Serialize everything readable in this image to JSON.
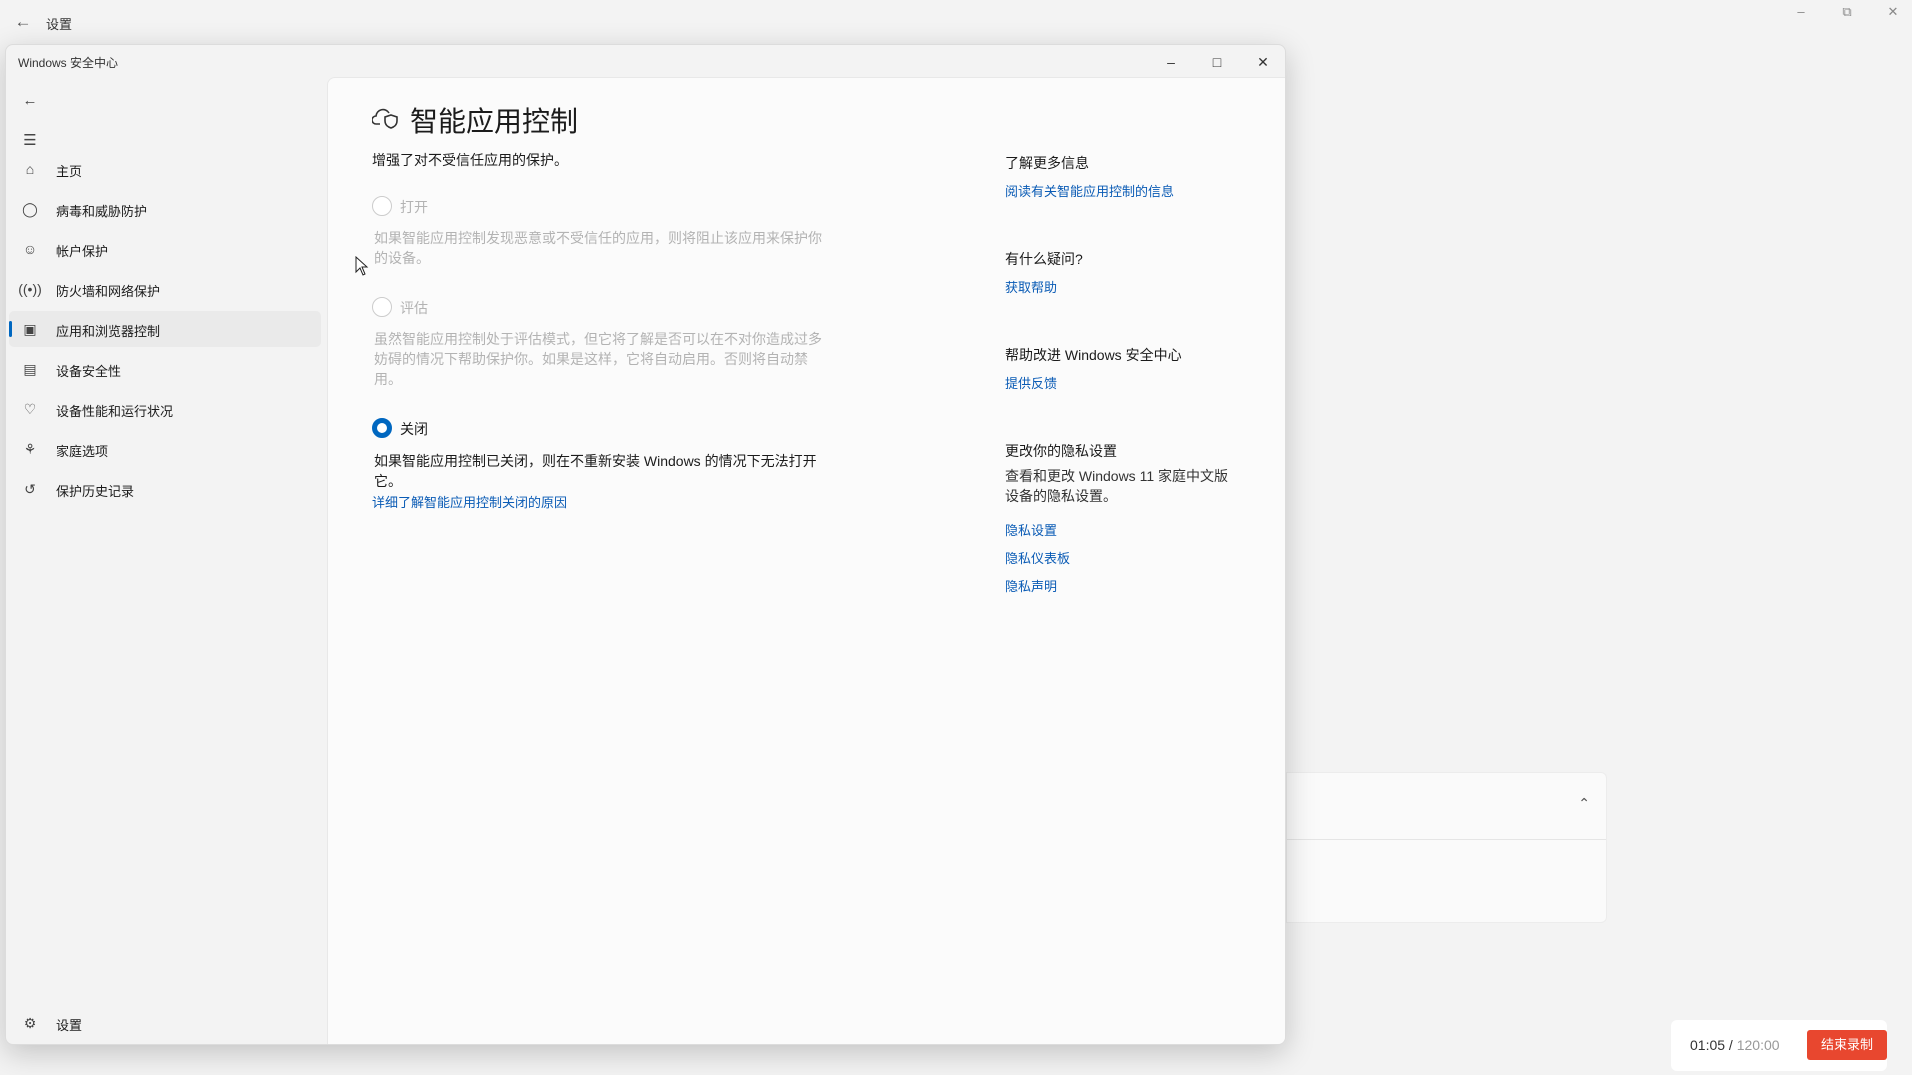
{
  "outer": {
    "title": "设置",
    "back_icon": "arrow-left"
  },
  "window": {
    "title": "Windows 安全中心",
    "sidebar": {
      "items": [
        {
          "label": "主页",
          "icon": "home"
        },
        {
          "label": "病毒和威胁防护",
          "icon": "shield"
        },
        {
          "label": "帐户保护",
          "icon": "person"
        },
        {
          "label": "防火墙和网络保护",
          "icon": "antenna"
        },
        {
          "label": "应用和浏览器控制",
          "icon": "app-window",
          "selected": true
        },
        {
          "label": "设备安全性",
          "icon": "laptop"
        },
        {
          "label": "设备性能和运行状况",
          "icon": "heart-pulse"
        },
        {
          "label": "家庭选项",
          "icon": "family"
        },
        {
          "label": "保护历史记录",
          "icon": "history"
        }
      ],
      "settings_label": "设置"
    },
    "main": {
      "title": "智能应用控制",
      "subtitle": "增强了对不受信任应用的保护。",
      "options": [
        {
          "label": "打开",
          "desc1": "如果智能应用控制发现恶意或不受信任的应用，则将阻止该应用来保护你",
          "desc2": "的设备。",
          "selected": false,
          "disabled": true
        },
        {
          "label": "评估",
          "desc1": "虽然智能应用控制处于评估模式，但它将了解是否可以在不对你造成过多",
          "desc2": "妨碍的情况下帮助保护你。如果是这样，它将自动启用。否则将自动禁",
          "desc3": "用。",
          "selected": false,
          "disabled": true
        },
        {
          "label": "关闭",
          "desc1": "如果智能应用控制已关闭，则在不重新安装 Windows 的情况下无法打开",
          "desc2": "它。",
          "selected": true,
          "disabled": false
        }
      ],
      "off_link": "详细了解智能应用控制关闭的原因"
    },
    "right": {
      "learn_more": {
        "heading": "了解更多信息",
        "link": "阅读有关智能应用控制的信息"
      },
      "questions": {
        "heading": "有什么疑问?",
        "link": "获取帮助"
      },
      "improve": {
        "heading": "帮助改进 Windows 安全中心",
        "link": "提供反馈"
      },
      "privacy": {
        "heading": "更改你的隐私设置",
        "desc1": "查看和更改 Windows 11 家庭中文版",
        "desc2": "设备的隐私设置。",
        "links": [
          "隐私设置",
          "隐私仪表板",
          "隐私声明"
        ]
      }
    }
  },
  "recorder": {
    "elapsed": "01:05",
    "separator": " / ",
    "total": "120:00",
    "stop_label": "结束录制",
    "accent": "#e8472f"
  },
  "accent": "#0067c0"
}
